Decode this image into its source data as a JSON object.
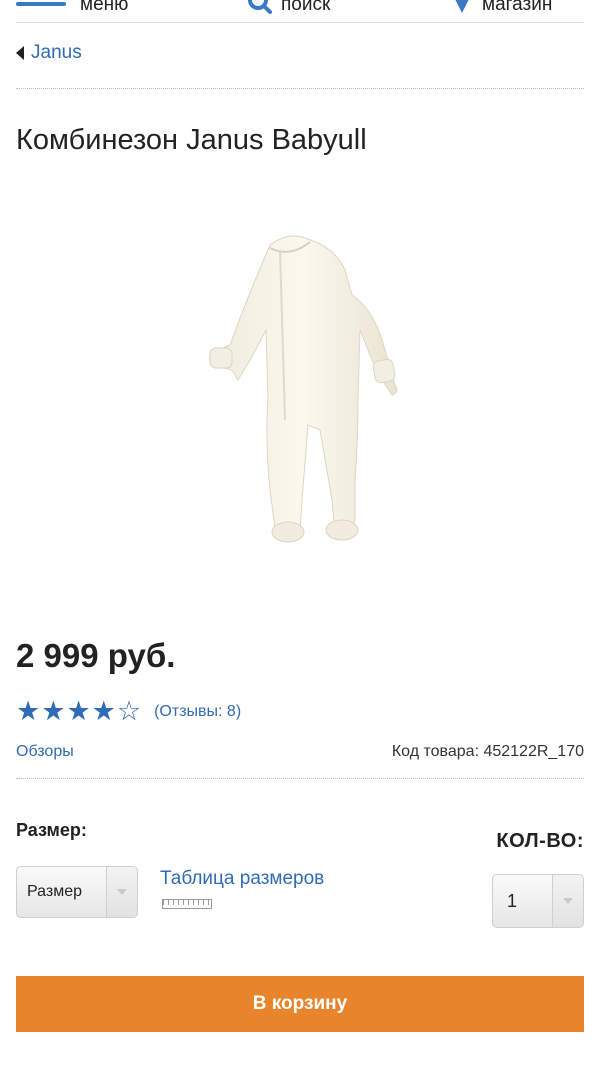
{
  "nav": {
    "menu_label": "меню",
    "search_label": "поиск",
    "store_label": "магазин"
  },
  "breadcrumb": {
    "back_label": "Janus"
  },
  "product": {
    "title": "Комбинезон Janus Babyull",
    "price": "2 999 руб.",
    "rating": 4,
    "rating_max": 5,
    "reviews_label": "(Отзывы: 8)",
    "overviews_label": "Обзоры",
    "sku_label": "Код товара: 452122R_170"
  },
  "options": {
    "size_label": "Размер:",
    "size_selected": "Размер",
    "size_table_label": "Таблица размеров",
    "qty_label": "КОЛ-ВО:",
    "qty_selected": "1"
  },
  "actions": {
    "add_to_cart_label": "В корзину"
  },
  "colors": {
    "accent": "#2f6cb5",
    "cart_button": "#e8842c"
  },
  "icons": {
    "menu": "hamburger-icon",
    "search": "search-icon",
    "store": "location-pin-icon",
    "back": "caret-left-icon",
    "ruler": "ruler-icon"
  }
}
